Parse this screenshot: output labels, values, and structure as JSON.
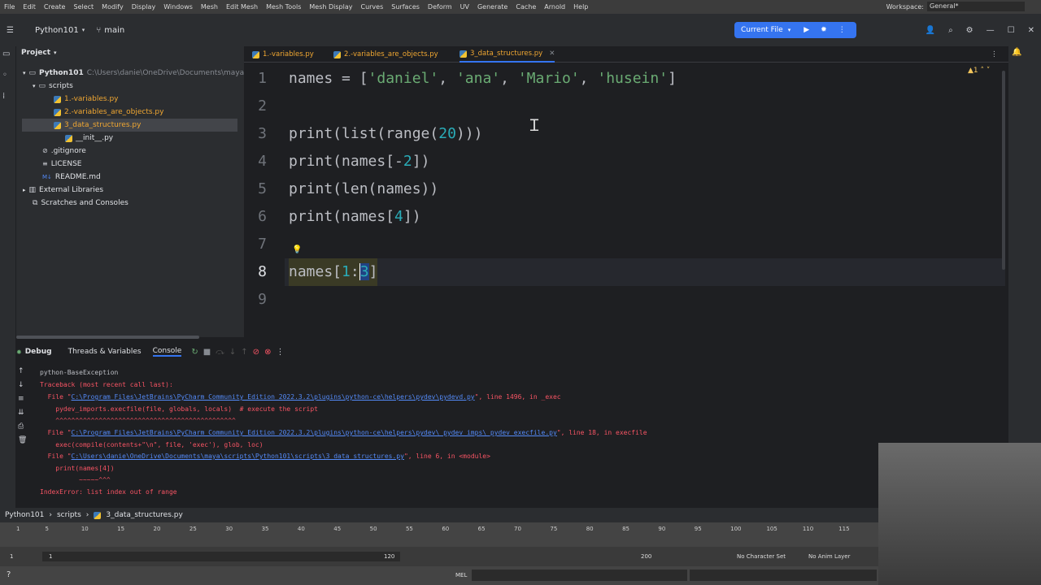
{
  "maya_menu": [
    "File",
    "Edit",
    "Create",
    "Select",
    "Modify",
    "Display",
    "Windows",
    "Mesh",
    "Edit Mesh",
    "Mesh Tools",
    "Mesh Display",
    "Curves",
    "Surfaces",
    "Deform",
    "UV",
    "Generate",
    "Cache",
    "Arnold",
    "Help"
  ],
  "workspace": {
    "label": "Workspace:",
    "value": "General*"
  },
  "toolbar": {
    "project": "Python101",
    "branch": "main",
    "run_config": "Current File"
  },
  "project_panel": {
    "title": "Project",
    "items": [
      {
        "label": "Python101",
        "path": "C:\\Users\\danie\\OneDrive\\Documents\\maya\\scri"
      },
      {
        "label": "scripts"
      },
      {
        "label": "1.-variables.py"
      },
      {
        "label": "2.-variables_are_objects.py"
      },
      {
        "label": "3_data_structures.py"
      },
      {
        "label": "__init__.py"
      },
      {
        "label": ".gitignore"
      },
      {
        "label": "LICENSE"
      },
      {
        "label": "README.md"
      },
      {
        "label": "External Libraries"
      },
      {
        "label": "Scratches and Consoles"
      }
    ]
  },
  "tabs": [
    "1.-variables.py",
    "2.-variables_are_objects.py",
    "3_data_structures.py"
  ],
  "editor": {
    "warning_count": "1",
    "line_numbers": [
      "1",
      "2",
      "3",
      "4",
      "5",
      "6",
      "7",
      "8",
      "9"
    ]
  },
  "debug": {
    "tabs": [
      "Debug",
      "Threads & Variables",
      "Console"
    ]
  },
  "console": {
    "lines": [
      "python-BaseException",
      "Traceback (most recent call last):",
      "  File \"",
      "C:\\Program Files\\JetBrains\\PyCharm Community Edition 2022.3.2\\plugins\\python-ce\\helpers\\pydev\\pydevd.py",
      "\", line 1496, in _exec",
      "    pydev_imports.execfile(file, globals, locals)  # execute the script",
      "    ^^^^^^^^^^^^^^^^^^^^^^^^^^^^^^^^^^^^^^^^^^^^^^",
      "C:\\Program Files\\JetBrains\\PyCharm Community Edition 2022.3.2\\plugins\\python-ce\\helpers\\pydev\\_pydev_imps\\_pydev_execfile.py",
      "\", line 18, in execfile",
      "    exec(compile(contents+\"\\n\", file, 'exec'), glob, loc)",
      "C:\\Users\\danie\\OneDrive\\Documents\\maya\\scripts\\Python101\\scripts\\3_data_structures.py",
      "\", line 6, in <module>",
      "    print(names[4])",
      "          ~~~~~^^^",
      "IndexError: list index out of range"
    ]
  },
  "breadcrumb": [
    "Python101",
    "scripts",
    "3_data_structures.py"
  ],
  "timeline": {
    "ticks": [
      "1",
      "5",
      "10",
      "15",
      "20",
      "25",
      "30",
      "35",
      "40",
      "45",
      "50",
      "55",
      "60",
      "65",
      "70",
      "75",
      "80",
      "85",
      "90",
      "95",
      "100",
      "105",
      "110",
      "115"
    ],
    "start": "1",
    "range_start": "1",
    "range_end": "120",
    "end": "200",
    "char_set": "No Character Set",
    "anim_layer": "No Anim Layer",
    "mel": "MEL"
  }
}
